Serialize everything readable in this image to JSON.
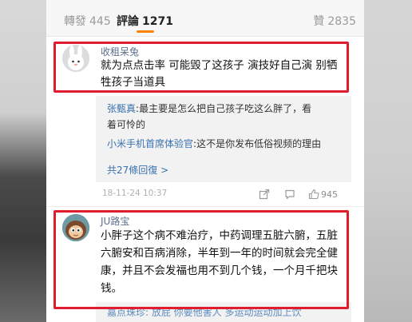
{
  "tabs": {
    "repost": {
      "label": "轉發",
      "count": "445"
    },
    "comments": {
      "label": "評論",
      "count": "1271"
    },
    "likes": {
      "label": "贊",
      "count": "2835"
    }
  },
  "comment1": {
    "username": "收租呆兔",
    "text_line1": "就为点点击率 可能毁了这孩子 演技好自己演 别牺",
    "text_line2": "牲孩子当道具",
    "replies": [
      {
        "name": "张甄真",
        "sep": ":",
        "text_line1": "最主要是怎么把自己孩子吃这么胖了，看",
        "text_line2": "着可怜的"
      },
      {
        "name": "小米手机首席体验官",
        "sep": ":",
        "text": "这不是你发布低俗视频的理由"
      }
    ],
    "more_replies": "共27條回復 >",
    "timestamp": "18-11-24 10:37",
    "like_count": "945"
  },
  "comment2": {
    "username": "JU路宝",
    "text_line1": "小胖子这个病不难治疗，中药调理五脏六腑，五脏",
    "text_line2": "六腑安和百病消除，半年到一年的时间就会完全健",
    "text_line3": "康，并且不会发福也用不到几个钱，一个月千把块",
    "text_line4": "钱。",
    "partial_reply": "嘉点珠珍: 放屁 你要他害人 多运动运动加上饮"
  },
  "colors": {
    "accent": "#ff8200",
    "highlight": "#e01c2e",
    "link": "#3a72b0"
  },
  "icons": [
    "share-icon",
    "comment-icon",
    "like-icon"
  ]
}
